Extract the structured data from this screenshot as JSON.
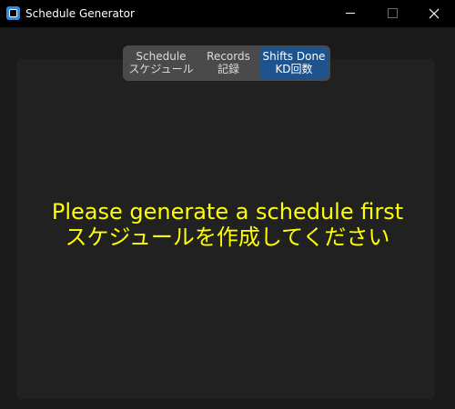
{
  "window": {
    "title": "Schedule Generator",
    "icon": "app-icon",
    "controls": {
      "minimize_icon": "minimize-icon",
      "maximize_icon": "maximize-icon",
      "close_icon": "close-icon"
    }
  },
  "tabs": [
    {
      "label_en": "Schedule",
      "label_jp": "スケジュール",
      "selected": false
    },
    {
      "label_en": "Records",
      "label_jp": "記録",
      "selected": false
    },
    {
      "label_en": "Shifts Done",
      "label_jp": "KD回数",
      "selected": true
    }
  ],
  "main": {
    "message_en": "Please generate a schedule first",
    "message_jp": "スケジュールを作成してください"
  },
  "colors": {
    "titlebar": "#000000",
    "background": "#1a1a1a",
    "panel": "#212121",
    "tab_bar": "#4a4a4a",
    "tab_selected": "#1f538d",
    "message": "#ffff00",
    "app_icon": "#1e90ff"
  }
}
